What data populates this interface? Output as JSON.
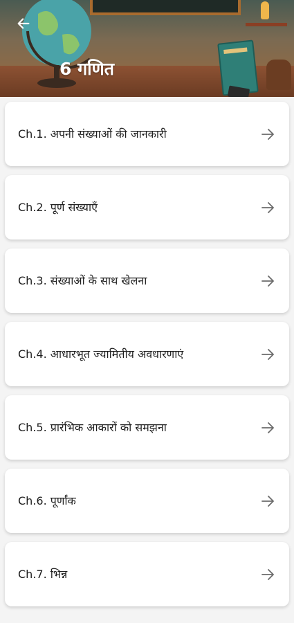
{
  "header": {
    "title": "6 गणित",
    "back_icon": "arrow-left-icon",
    "title_color": "#ffffff"
  },
  "chapters": [
    {
      "label": "Ch.1. अपनी संख्याओं की जानकारी",
      "icon": "arrow-right-icon"
    },
    {
      "label": "Ch.2. पूर्ण संख्याएँ",
      "icon": "arrow-right-icon"
    },
    {
      "label": "Ch.3. संख्याओं के साथ खेलना",
      "icon": "arrow-right-icon"
    },
    {
      "label": "Ch.4. आधारभूत ज्यामितीय अवधारणाएं",
      "icon": "arrow-right-icon"
    },
    {
      "label": "Ch.5. प्रारंभिक आकारों को समझना",
      "icon": "arrow-right-icon"
    },
    {
      "label": "Ch.6. पूर्णांक",
      "icon": "arrow-right-icon"
    },
    {
      "label": "Ch.7. भिन्न",
      "icon": "arrow-right-icon"
    }
  ],
  "colors": {
    "background": "#f4f4f4",
    "card": "#ffffff",
    "text": "#1e1e1e",
    "arrow": "#6b6b6b"
  }
}
